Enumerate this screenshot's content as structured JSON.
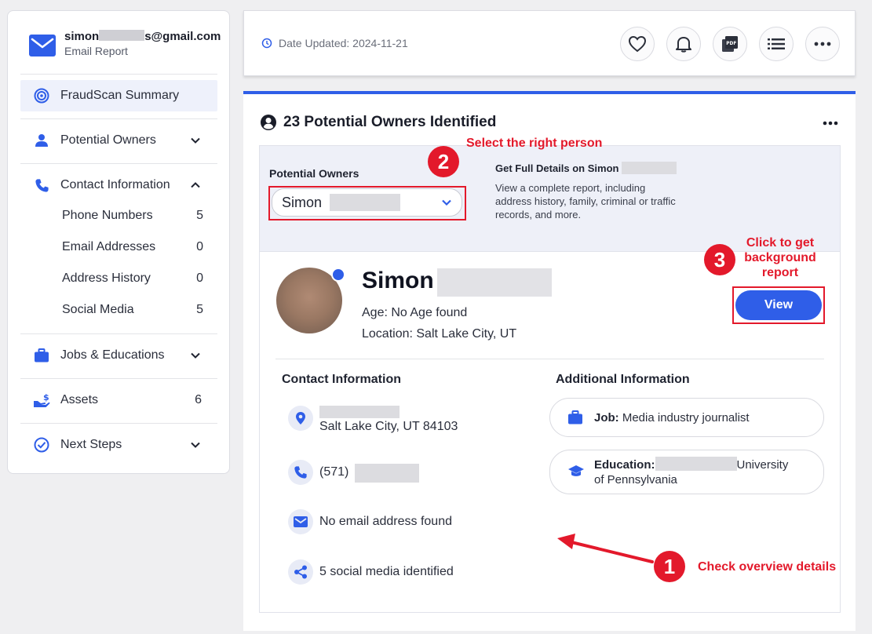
{
  "account": {
    "email_prefix": "simon",
    "email_suffix": "s@gmail.com",
    "subtitle": "Email Report"
  },
  "sidebar": {
    "items": [
      {
        "label": "FraudScan Summary",
        "icon": "target-icon",
        "active": true
      },
      {
        "label": "Potential Owners",
        "icon": "person-icon",
        "chevron": "down"
      },
      {
        "label": "Contact Information",
        "icon": "phone-icon",
        "chevron": "up",
        "subitems": [
          {
            "label": "Phone Numbers",
            "count": "5"
          },
          {
            "label": "Email Addresses",
            "count": "0"
          },
          {
            "label": "Address History",
            "count": "0"
          },
          {
            "label": "Social Media",
            "count": "5"
          }
        ]
      },
      {
        "label": "Jobs & Educations",
        "icon": "briefcase-icon",
        "chevron": "down"
      },
      {
        "label": "Assets",
        "icon": "assets-icon",
        "count": "6"
      },
      {
        "label": "Next Steps",
        "icon": "check-circle-icon",
        "chevron": "down"
      }
    ]
  },
  "topbar": {
    "date_updated": "Date Updated: 2024-11-21",
    "buttons": [
      "heart-icon",
      "bell-icon",
      "pdf-icon",
      "list-icon",
      "more-icon"
    ]
  },
  "main": {
    "title": "23 Potential Owners Identified",
    "selector": {
      "label": "Potential Owners",
      "selected": "Simon"
    },
    "get_details": {
      "title": "Get Full Details on Simon",
      "description": "View a complete report, including address history, family, criminal or traffic records, and more."
    },
    "person": {
      "first_name": "Simon",
      "age": "Age: No Age found",
      "location": "Location: Salt Lake City, UT",
      "view_label": "View"
    },
    "contact": {
      "title": "Contact Information",
      "address": "Salt Lake City, UT 84103",
      "phone": "(571)",
      "email": "No email address found",
      "social": "5 social media identified"
    },
    "additional": {
      "title": "Additional Information",
      "job_label": "Job:",
      "job_value": "Media industry journalist",
      "education_label": "Education:",
      "education_value_1": "University",
      "education_value_2": "of Pennsylvania"
    }
  },
  "annotations": {
    "step1": {
      "number": "1",
      "text": "Check overview details"
    },
    "step2": {
      "number": "2",
      "text": "Select the right person"
    },
    "step3": {
      "number": "3",
      "text": "Click to get background report"
    }
  },
  "colors": {
    "accent": "#2f5ee8",
    "annotation": "#e3192b"
  }
}
